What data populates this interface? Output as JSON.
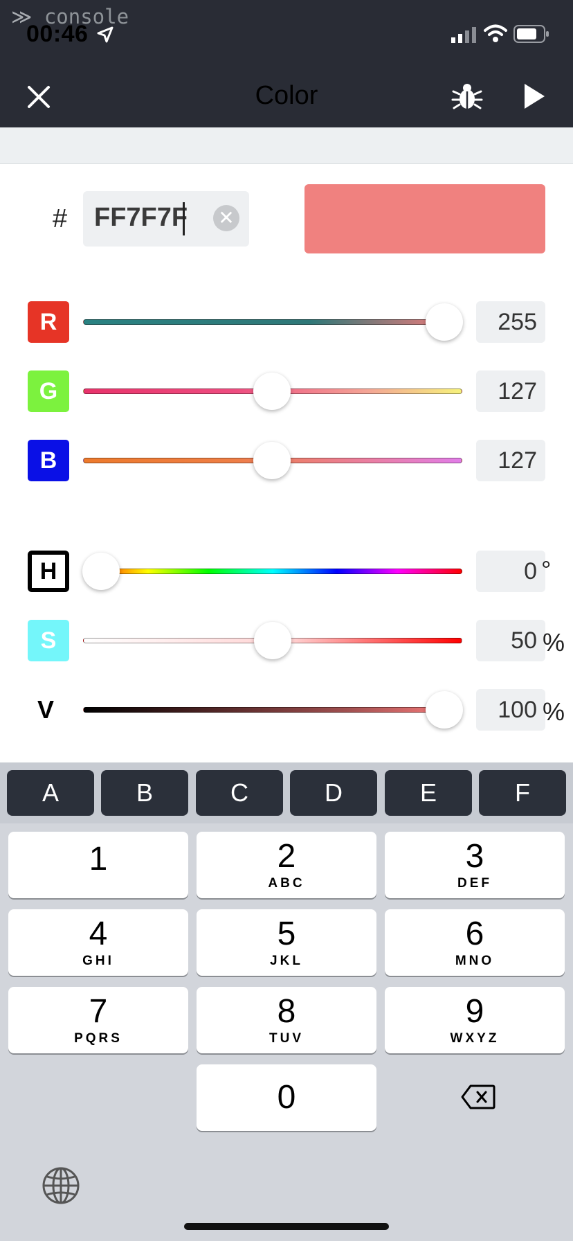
{
  "status": {
    "time": "00:46"
  },
  "header": {
    "title": "Color"
  },
  "console": {
    "label": "console"
  },
  "hex": {
    "hash": "#",
    "value": "FF7F7F",
    "preview_color": "#F0817F"
  },
  "rgb": [
    {
      "key": "r",
      "label": "R",
      "value": "255",
      "color": "#E63426"
    },
    {
      "key": "g",
      "label": "G",
      "value": "127",
      "color": "#7CF23E"
    },
    {
      "key": "b",
      "label": "B",
      "value": "127",
      "color": "#0A10E6"
    }
  ],
  "hsv": [
    {
      "key": "h",
      "label": "H",
      "value": "0",
      "unit": "°"
    },
    {
      "key": "s",
      "label": "S",
      "value": "50",
      "unit": "%",
      "color": "#74F6FA"
    },
    {
      "key": "v",
      "label": "V",
      "value": "100",
      "unit": "%"
    }
  ],
  "slider_fraction": {
    "r": 1.0,
    "g": 0.498,
    "b": 0.498,
    "h": 0.0,
    "s": 0.5,
    "v": 1.0
  },
  "hex_keys": [
    "A",
    "B",
    "C",
    "D",
    "E",
    "F"
  ],
  "num_keys": [
    {
      "digit": "1",
      "letters": ""
    },
    {
      "digit": "2",
      "letters": "ABC"
    },
    {
      "digit": "3",
      "letters": "DEF"
    },
    {
      "digit": "4",
      "letters": "GHI"
    },
    {
      "digit": "5",
      "letters": "JKL"
    },
    {
      "digit": "6",
      "letters": "MNO"
    },
    {
      "digit": "7",
      "letters": "PQRS"
    },
    {
      "digit": "8",
      "letters": "TUV"
    },
    {
      "digit": "9",
      "letters": "WXYZ"
    },
    {
      "digit": "0",
      "letters": ""
    }
  ],
  "icons": [
    "location-arrow-icon",
    "signal-icon",
    "wifi-icon",
    "battery-icon",
    "close-icon",
    "bug-icon",
    "play-icon",
    "clear-icon",
    "backspace-icon",
    "globe-icon"
  ]
}
